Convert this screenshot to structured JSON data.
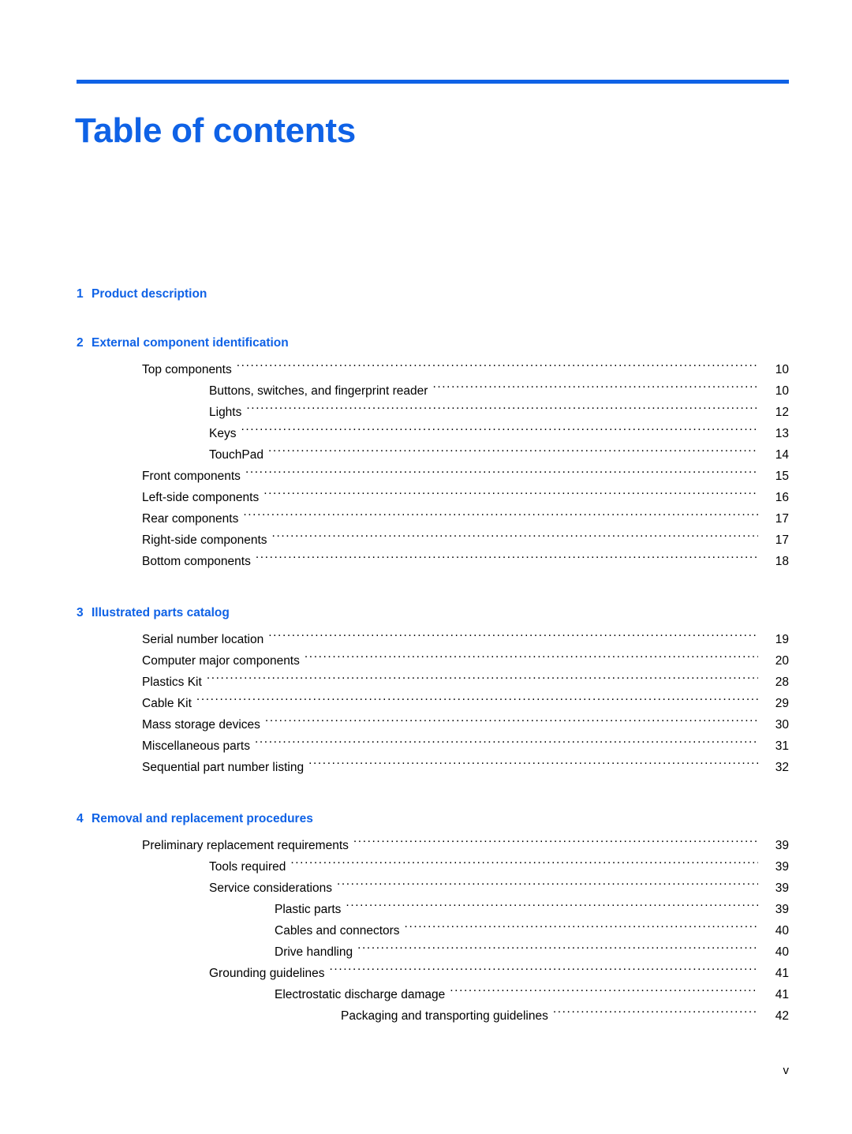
{
  "document": {
    "title": "Table of contents",
    "accent_color": "#0f62e6",
    "text_color": "#000000",
    "background_color": "#ffffff",
    "footer_page_number": "v"
  },
  "toc": {
    "chapters": [
      {
        "number": "1",
        "title": "Product description",
        "entries": []
      },
      {
        "number": "2",
        "title": "External component identification",
        "entries": [
          {
            "level": 1,
            "label": "Top components",
            "page": "10"
          },
          {
            "level": 2,
            "label": "Buttons, switches, and fingerprint reader",
            "page": "10"
          },
          {
            "level": 2,
            "label": "Lights",
            "page": "12"
          },
          {
            "level": 2,
            "label": "Keys",
            "page": "13"
          },
          {
            "level": 2,
            "label": "TouchPad",
            "page": "14"
          },
          {
            "level": 1,
            "label": "Front components",
            "page": "15"
          },
          {
            "level": 1,
            "label": "Left-side components",
            "page": "16"
          },
          {
            "level": 1,
            "label": "Rear components",
            "page": "17"
          },
          {
            "level": 1,
            "label": "Right-side components",
            "page": "17"
          },
          {
            "level": 1,
            "label": "Bottom components",
            "page": "18"
          }
        ]
      },
      {
        "number": "3",
        "title": "Illustrated parts catalog",
        "entries": [
          {
            "level": 1,
            "label": "Serial number location",
            "page": "19"
          },
          {
            "level": 1,
            "label": "Computer major components",
            "page": "20"
          },
          {
            "level": 1,
            "label": "Plastics Kit",
            "page": "28"
          },
          {
            "level": 1,
            "label": "Cable Kit",
            "page": "29"
          },
          {
            "level": 1,
            "label": "Mass storage devices",
            "page": "30"
          },
          {
            "level": 1,
            "label": "Miscellaneous parts",
            "page": "31"
          },
          {
            "level": 1,
            "label": "Sequential part number listing",
            "page": "32"
          }
        ]
      },
      {
        "number": "4",
        "title": "Removal and replacement procedures",
        "entries": [
          {
            "level": 1,
            "label": "Preliminary replacement requirements",
            "page": "39"
          },
          {
            "level": 2,
            "label": "Tools required",
            "page": "39"
          },
          {
            "level": 2,
            "label": "Service considerations",
            "page": "39"
          },
          {
            "level": 3,
            "label": "Plastic parts",
            "page": "39"
          },
          {
            "level": 3,
            "label": "Cables and connectors",
            "page": "40"
          },
          {
            "level": 3,
            "label": "Drive handling",
            "page": "40"
          },
          {
            "level": 2,
            "label": "Grounding guidelines",
            "page": "41"
          },
          {
            "level": 3,
            "label": "Electrostatic discharge damage",
            "page": "41"
          },
          {
            "level": 4,
            "label": "Packaging and transporting guidelines",
            "page": "42"
          }
        ]
      }
    ]
  }
}
